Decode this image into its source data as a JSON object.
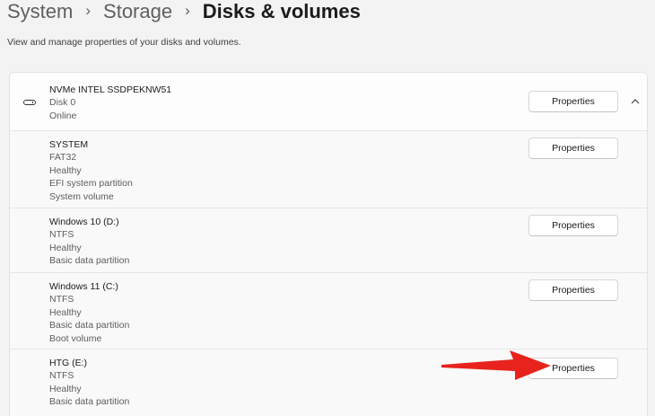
{
  "breadcrumb": {
    "items": [
      "System",
      "Storage",
      "Disks & volumes"
    ],
    "separator": "›"
  },
  "subtitle": "View and manage properties of your disks and volumes.",
  "disk": {
    "name": "NVMe INTEL SSDPEKNW51",
    "number": "Disk 0",
    "status": "Online",
    "button_label": "Properties",
    "icon": "drive-icon",
    "expand_icon": "chevron-up-icon"
  },
  "volumes": [
    {
      "name": "SYSTEM",
      "details": [
        "FAT32",
        "Healthy",
        "EFI system partition",
        "System volume"
      ],
      "button_label": "Properties"
    },
    {
      "name": "Windows 10 (D:)",
      "details": [
        "NTFS",
        "Healthy",
        "Basic data partition"
      ],
      "button_label": "Properties"
    },
    {
      "name": "Windows 11 (C:)",
      "details": [
        "NTFS",
        "Healthy",
        "Basic data partition",
        "Boot volume"
      ],
      "button_label": "Properties"
    },
    {
      "name": "HTG (E:)",
      "details": [
        "NTFS",
        "Healthy",
        "Basic data partition"
      ],
      "button_label": "Properties"
    }
  ],
  "annotation": {
    "icon": "red-arrow-annotation",
    "color": "#e8231d"
  }
}
